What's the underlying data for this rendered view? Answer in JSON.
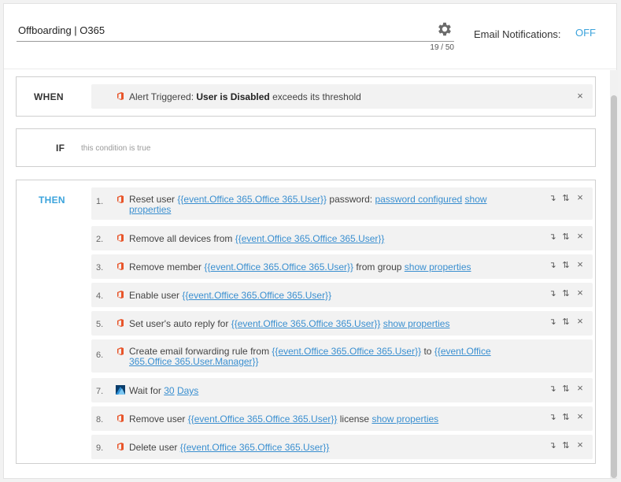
{
  "header": {
    "workflow_name": "Offboarding | O365",
    "char_counter": "19 / 50",
    "email_notifications_label": "Email Notifications:",
    "email_notifications_state": "OFF"
  },
  "when": {
    "label": "WHEN",
    "alert_prefix": "Alert Triggered:",
    "alert_name": "User is Disabled",
    "alert_suffix": "exceeds its threshold",
    "remove_icon": "×"
  },
  "if": {
    "label": "IF",
    "placeholder": "this condition is true"
  },
  "then": {
    "label": "THEN",
    "actions": [
      {
        "num": "1.",
        "pre": "Reset user",
        "l1": "{{event.Office 365.Office 365.User}}",
        "mid": "password:",
        "l2": "password configured",
        "l3": "show",
        "l4": "properties"
      },
      {
        "num": "2.",
        "pre": "Remove all devices from",
        "l1": "{{event.Office 365.Office 365.User}}"
      },
      {
        "num": "3.",
        "pre": "Remove member",
        "l1": "{{event.Office 365.Office 365.User}}",
        "mid": "from group",
        "l2": "show properties"
      },
      {
        "num": "4.",
        "pre": "Enable user",
        "l1": "{{event.Office 365.Office 365.User}}"
      },
      {
        "num": "5.",
        "pre": "Set user's auto reply for",
        "l1": "{{event.Office 365.Office 365.User}}",
        "l2": "show properties"
      },
      {
        "num": "6.",
        "pre": "Create email forwarding rule from",
        "l1": "{{event.Office 365.Office 365.User}}",
        "mid": "to",
        "l2": "{{event.Office",
        "l3": "365.Office 365.User.Manager}}"
      },
      {
        "num": "7.",
        "pre": "Wait for",
        "l1": "30",
        "l2": "Days"
      },
      {
        "num": "8.",
        "pre": "Remove user",
        "l1": "{{event.Office 365.Office 365.User}}",
        "mid": "license",
        "l2": "show properties"
      },
      {
        "num": "9.",
        "pre": "Delete user",
        "l1": "{{event.Office 365.Office 365.User}}"
      }
    ],
    "controls": {
      "move_down": "↴",
      "reorder": "⇅",
      "remove": "×"
    }
  },
  "colors": {
    "accent": "#3ba3dc",
    "link": "#3a8fd0",
    "o365": "#e8552a"
  },
  "icons": {
    "settings": "gear-icon",
    "office365": "office365-icon",
    "wait": "azure-icon"
  }
}
